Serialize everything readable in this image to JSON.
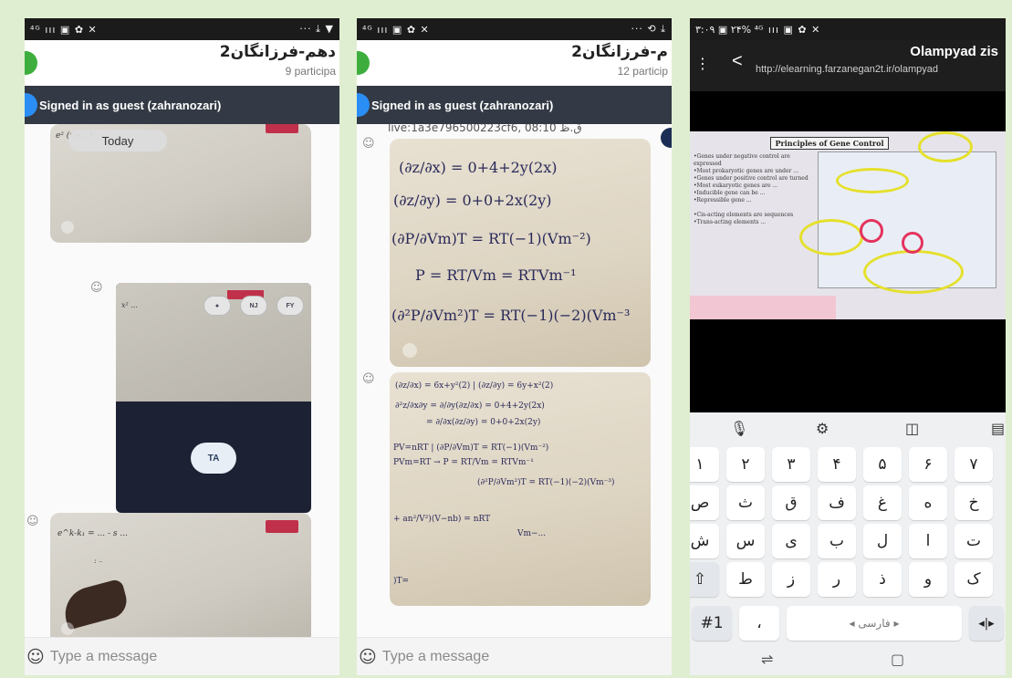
{
  "panel1": {
    "status_left": "⁴ᴳ ııı ▣ ✿ ✕",
    "status_right": "··· ⤓ ▼",
    "chat_title": "دهم-فرزانگان2",
    "participants": "9 participa",
    "guest_banner": "Signed in as guest (zahranozari)",
    "today_label": "Today",
    "video_pills": [
      "●",
      "NJ",
      "FY"
    ],
    "video_ta": "TA",
    "input_placeholder": "Type a message"
  },
  "panel2": {
    "status_left": "⁴ᴳ ııı ▣ ✿ ✕",
    "status_right": "··· ⟲ ⤓",
    "chat_title": "م-فرزانگان2",
    "participants": "12 particip",
    "guest_banner": "Signed in as guest (zahranozari)",
    "live_label": "live:1a3e796500223cf6, 08:10 ق.ظ",
    "equations": [
      "(∂z/∂x) = 0+4+2y(2x)",
      "(∂z/∂y) = 0+0+2x(2y)",
      "(∂P/∂Vm)T = RT(−1)(Vm⁻²)",
      "P = RT/Vm = RTVm⁻¹",
      "(∂²P/∂Vm²)T = RT(−1)(−2)(Vm⁻³"
    ],
    "input_placeholder": "Type a message"
  },
  "panel3": {
    "status_left": "۳:۰۹ ▣ ۲۴% ⁴ᴳ ııı ▣ ✿ ✕",
    "page_title": "Olampyad zis",
    "url": "http://elearning.farzanegan2t.ir/olampyad",
    "slide_title": "Principles of Gene Control",
    "keyboard_rows": [
      [
        "۱",
        "۲",
        "۳",
        "۴",
        "۵",
        "۶",
        "۷"
      ],
      [
        "ص",
        "ث",
        "ق",
        "ف",
        "غ",
        "ه",
        "خ"
      ],
      [
        "ش",
        "س",
        "ی",
        "ب",
        "ل",
        "ا",
        "ت"
      ],
      [
        "⇧",
        "ط",
        "ز",
        "ر",
        "ذ",
        "و",
        "ک"
      ]
    ],
    "key_symbols": "#1",
    "key_comma": "،",
    "space_label": "◂ فارسی ▸",
    "key_arrows": "◂|▸"
  }
}
